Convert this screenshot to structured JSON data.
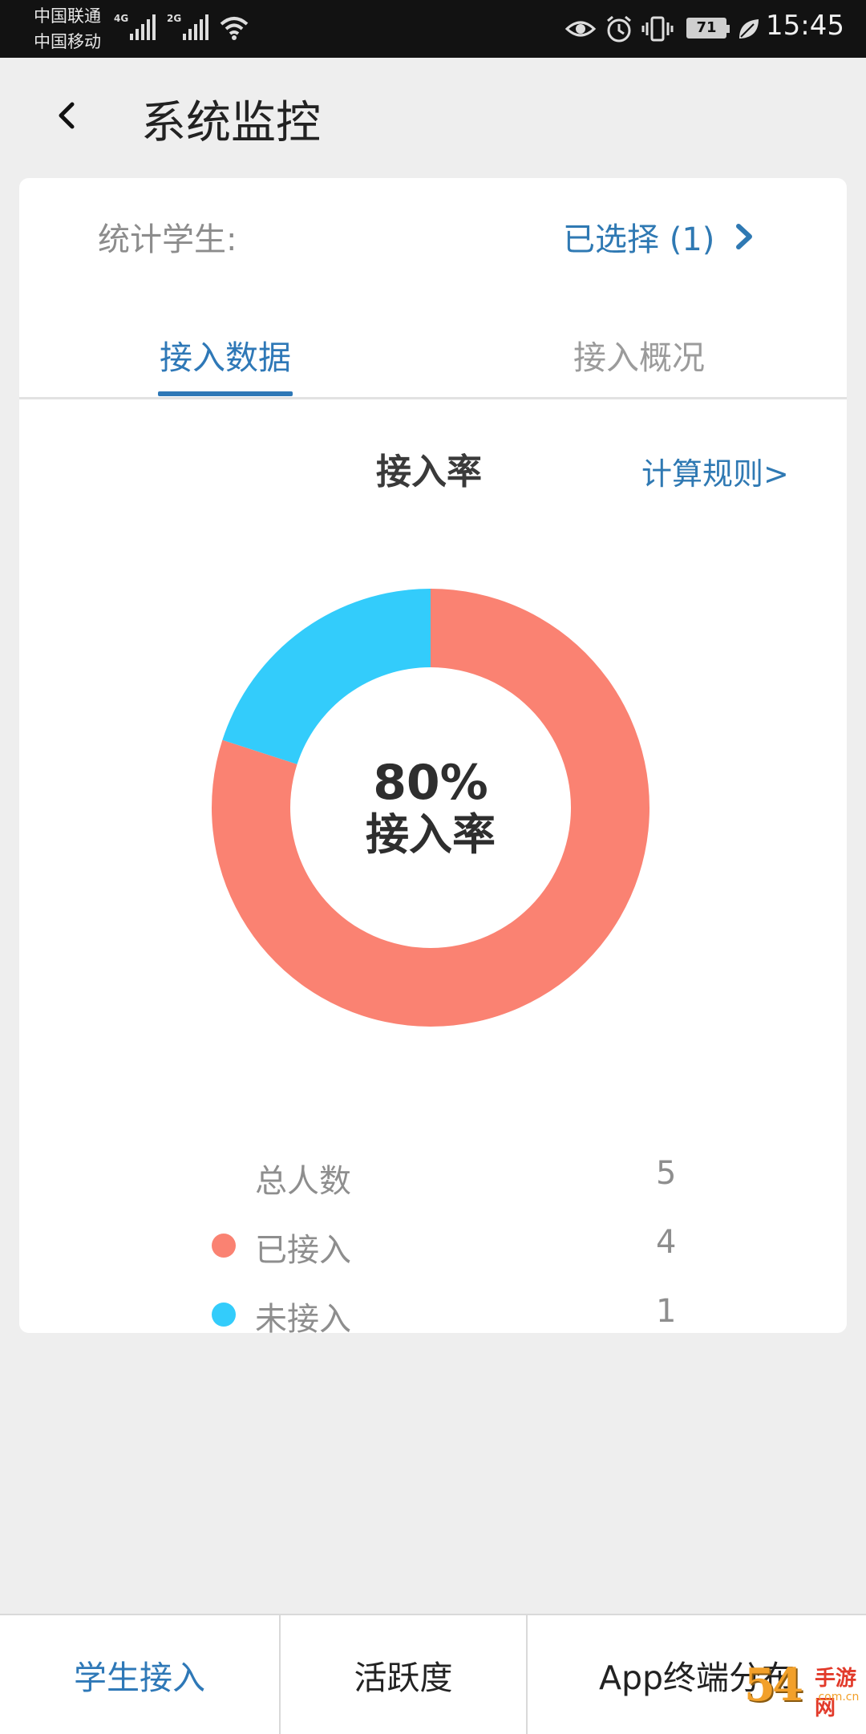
{
  "status_bar": {
    "carrier_1": "中国联通",
    "carrier_2": "中国移动",
    "network_1": "4G",
    "network_2": "2G",
    "battery": "71",
    "time": "15:45",
    "icons": [
      "signal-icon",
      "wifi-icon",
      "eye-icon",
      "alarm-icon",
      "vibrate-icon",
      "battery-icon",
      "leaf-icon"
    ]
  },
  "header": {
    "back_icon": "chevron-left-icon",
    "title": "系统监控"
  },
  "filter": {
    "label": "统计学生:",
    "value": "已选择 (1)"
  },
  "tabs": [
    {
      "label": "接入数据",
      "active": true
    },
    {
      "label": "接入概况",
      "active": false
    }
  ],
  "section": {
    "title": "接入率",
    "rule_link": "计算规则>"
  },
  "chart_data": {
    "type": "pie",
    "style": "donut",
    "center_value": "80%",
    "center_label": "接入率",
    "series": [
      {
        "name": "已接入",
        "value": 4,
        "color": "#fa8272"
      },
      {
        "name": "未接入",
        "value": 1,
        "color": "#33ccfb"
      }
    ]
  },
  "stats": {
    "total": {
      "label": "总人数",
      "value": "5"
    },
    "connected": {
      "label": "已接入",
      "value": "4",
      "color": "#fa8272"
    },
    "not_connected": {
      "label": "未接入",
      "value": "1",
      "color": "#33ccfb"
    }
  },
  "bottom_nav": [
    {
      "label": "学生接入",
      "active": true
    },
    {
      "label": "活跃度",
      "active": false
    },
    {
      "label": "App终端分布",
      "active": false
    }
  ],
  "watermark": {
    "number": "54",
    "text": "手游网",
    "url": ".com.cn"
  }
}
